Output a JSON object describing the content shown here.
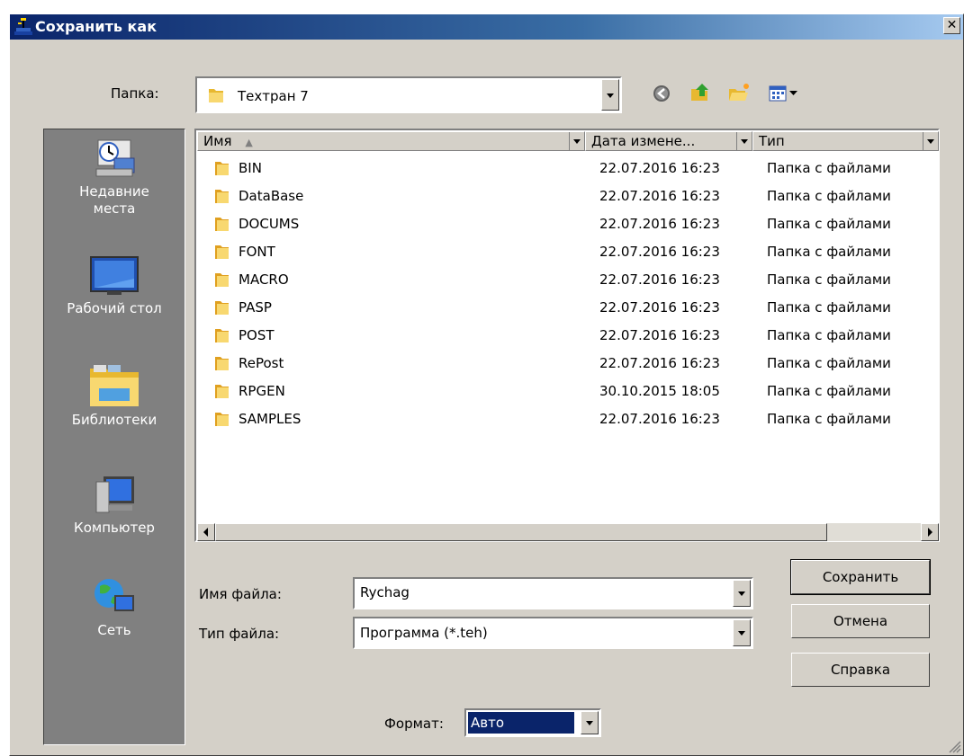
{
  "window": {
    "title": "Сохранить как",
    "close_glyph": "✕"
  },
  "folder_bar": {
    "label": "Папка:",
    "current": "Техтран 7",
    "toolbar_icons": [
      "back-icon",
      "up-folder-icon",
      "new-folder-icon",
      "view-menu-icon"
    ]
  },
  "places": [
    {
      "label_line1": "Недавние",
      "label_line2": "места",
      "icon": "recent-places-icon"
    },
    {
      "label_line1": "Рабочий стол",
      "label_line2": "",
      "icon": "desktop-icon"
    },
    {
      "label_line1": "Библиотеки",
      "label_line2": "",
      "icon": "libraries-icon"
    },
    {
      "label_line1": "Компьютер",
      "label_line2": "",
      "icon": "computer-icon"
    },
    {
      "label_line1": "Сеть",
      "label_line2": "",
      "icon": "network-icon"
    }
  ],
  "file_list": {
    "columns": [
      "Имя",
      "Дата измене...",
      "Тип"
    ],
    "sort_indicator": "▲",
    "rows": [
      {
        "name": "BIN",
        "date": "22.07.2016 16:23",
        "type": "Папка с файлами"
      },
      {
        "name": "DataBase",
        "date": "22.07.2016 16:23",
        "type": "Папка с файлами"
      },
      {
        "name": "DOCUMS",
        "date": "22.07.2016 16:23",
        "type": "Папка с файлами"
      },
      {
        "name": "FONT",
        "date": "22.07.2016 16:23",
        "type": "Папка с файлами"
      },
      {
        "name": "MACRO",
        "date": "22.07.2016 16:23",
        "type": "Папка с файлами"
      },
      {
        "name": "PASP",
        "date": "22.07.2016 16:23",
        "type": "Папка с файлами"
      },
      {
        "name": "POST",
        "date": "22.07.2016 16:23",
        "type": "Папка с файлами"
      },
      {
        "name": "RePost",
        "date": "22.07.2016 16:23",
        "type": "Папка с файлами"
      },
      {
        "name": "RPGEN",
        "date": "30.10.2015 18:05",
        "type": "Папка с файлами"
      },
      {
        "name": "SAMPLES",
        "date": "22.07.2016 16:23",
        "type": "Папка с файлами"
      }
    ]
  },
  "form": {
    "filename_label": "Имя файла:",
    "filename_value": "Rychag",
    "filetype_label": "Тип файла:",
    "filetype_value": "Программа (*.teh)",
    "format_label": "Формат:",
    "format_value": "Авто"
  },
  "buttons": {
    "save": "Сохранить",
    "cancel": "Отмена",
    "help": "Справка"
  },
  "colors": {
    "title_start": "#0a246a",
    "title_end": "#a6caf0",
    "dialog_bg": "#d4d0c8",
    "places_bg": "#808080",
    "selection": "#0a246a"
  }
}
